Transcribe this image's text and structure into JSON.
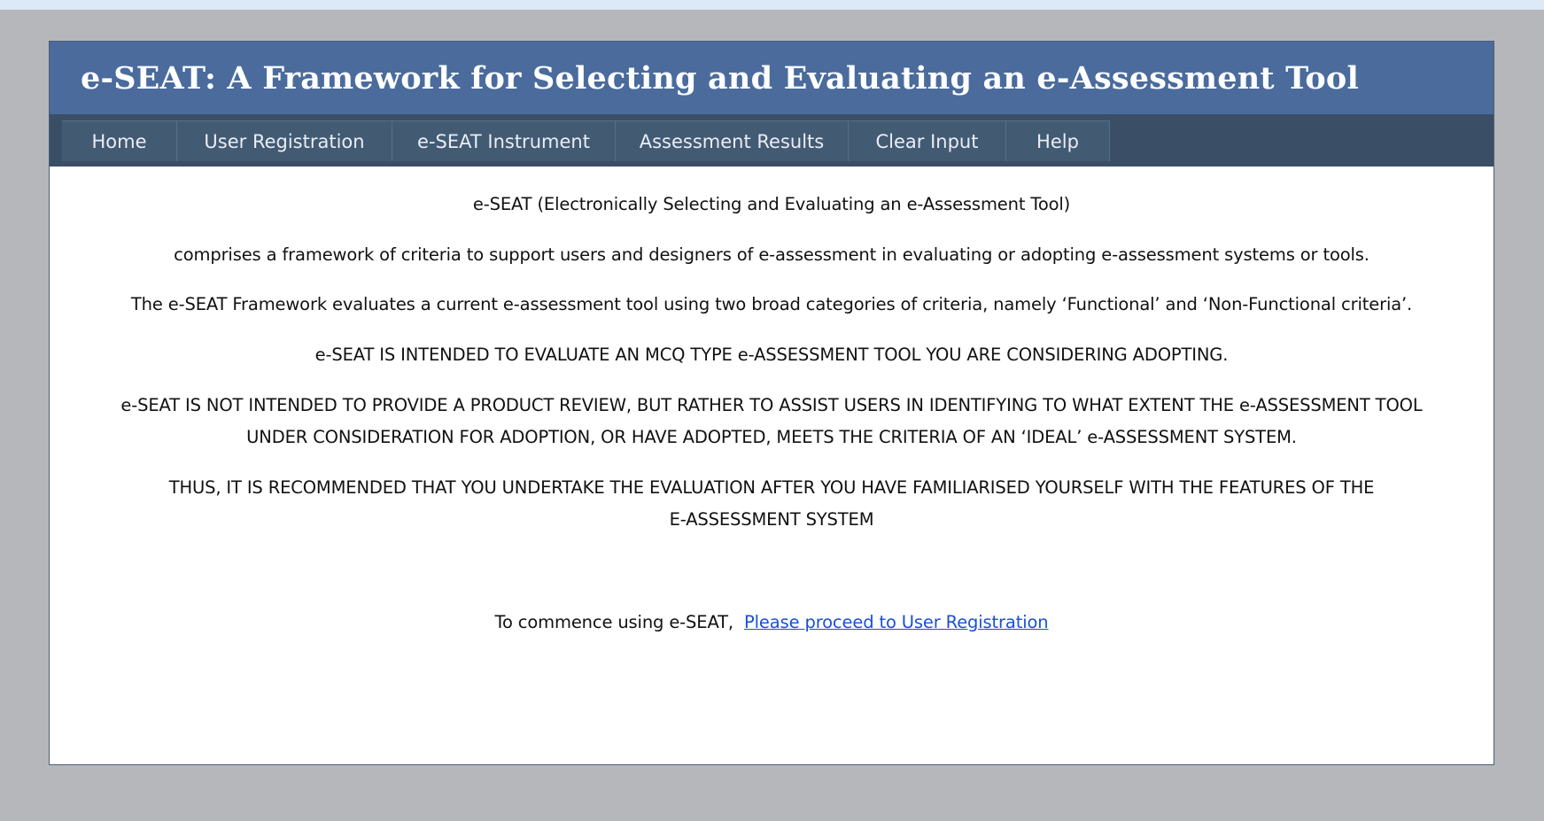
{
  "app": {
    "title": "e-SEAT: A Framework for Selecting and Evaluating an e-Assessment Tool"
  },
  "nav": {
    "items": [
      {
        "label": "Home"
      },
      {
        "label": "User Registration"
      },
      {
        "label": "e-SEAT Instrument"
      },
      {
        "label": "Assessment Results"
      },
      {
        "label": "Clear Input"
      },
      {
        "label": "Help"
      }
    ]
  },
  "content": {
    "p1": "e-SEAT (Electronically Selecting and Evaluating an e-Assessment Tool)",
    "p2": "comprises a framework of criteria to support users and designers of e-assessment in evaluating or adopting e-assessment systems or tools.",
    "p3": "The e-SEAT Framework evaluates a current e-assessment tool using two broad categories of criteria, namely ‘Functional’ and ‘Non-Functional criteria’.",
    "p4": "e-SEAT IS INTENDED TO EVALUATE AN MCQ TYPE e-ASSESSMENT TOOL YOU ARE CONSIDERING ADOPTING.",
    "p5_line1": "e-SEAT IS NOT INTENDED TO PROVIDE A PRODUCT REVIEW, BUT RATHER TO ASSIST USERS IN IDENTIFYING TO WHAT EXTENT THE e-ASSESSMENT TOOL",
    "p5_line2": "UNDER CONSIDERATION FOR ADOPTION, OR HAVE ADOPTED, MEETS THE CRITERIA OF AN ‘IDEAL’ e-ASSESSMENT SYSTEM.",
    "p6_line1": "THUS, IT IS RECOMMENDED THAT YOU UNDERTAKE THE EVALUATION AFTER YOU HAVE FAMILIARISED YOURSELF WITH THE FEATURES OF THE",
    "p6_line2": "E-ASSESSMENT SYSTEM",
    "commence_text": "To commence using e-SEAT,",
    "commence_link": "Please proceed to User Registration"
  },
  "colors": {
    "banner": "#4a6b9c",
    "navbar": "#3a4f65",
    "nav_item": "#435a73",
    "link": "#1a4fd6",
    "background": "#b6b7bb"
  }
}
